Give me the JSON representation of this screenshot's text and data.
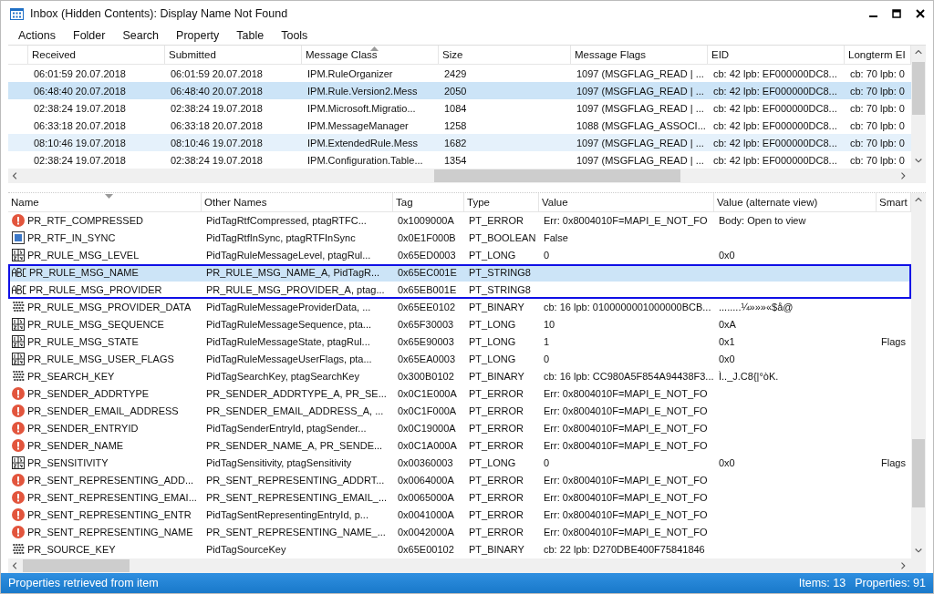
{
  "window": {
    "title": "Inbox (Hidden Contents): Display Name Not Found"
  },
  "menu": [
    "Actions",
    "Folder",
    "Search",
    "Property",
    "Table",
    "Tools"
  ],
  "items_table": {
    "columns": [
      {
        "label": "Received",
        "sorted": false
      },
      {
        "label": "Submitted",
        "sorted": false
      },
      {
        "label": "Message Class",
        "sorted": true
      },
      {
        "label": "Size",
        "sorted": false
      },
      {
        "label": "Message Flags",
        "sorted": false
      },
      {
        "label": "EID",
        "sorted": false
      },
      {
        "label": "Longterm EI",
        "sorted": false
      }
    ],
    "rows": [
      {
        "selected": false,
        "hovered": false,
        "cells": [
          "06:01:59 20.07.2018",
          "06:01:59 20.07.2018",
          "IPM.RuleOrganizer",
          "2429",
          "1097 (MSGFLAG_READ | ...",
          "cb: 42 lpb: EF000000DC8...",
          "cb: 70 lpb: 0"
        ]
      },
      {
        "selected": true,
        "hovered": false,
        "cells": [
          "06:48:40 20.07.2018",
          "06:48:40 20.07.2018",
          "IPM.Rule.Version2.Mess",
          "2050",
          "1097 (MSGFLAG_READ | ...",
          "cb: 42 lpb: EF000000DC8...",
          "cb: 70 lpb: 0"
        ]
      },
      {
        "selected": false,
        "hovered": false,
        "cells": [
          "02:38:24 19.07.2018",
          "02:38:24 19.07.2018",
          "IPM.Microsoft.Migratio...",
          "1084",
          "1097 (MSGFLAG_READ | ...",
          "cb: 42 lpb: EF000000DC8...",
          "cb: 70 lpb: 0"
        ]
      },
      {
        "selected": false,
        "hovered": false,
        "cells": [
          "06:33:18 20.07.2018",
          "06:33:18 20.07.2018",
          "IPM.MessageManager",
          "1258",
          "1088 (MSGFLAG_ASSOCI...",
          "cb: 42 lpb: EF000000DC8...",
          "cb: 70 lpb: 0"
        ]
      },
      {
        "selected": false,
        "hovered": true,
        "cells": [
          "08:10:46 19.07.2018",
          "08:10:46 19.07.2018",
          "IPM.ExtendedRule.Mess",
          "1682",
          "1097 (MSGFLAG_READ | ...",
          "cb: 42 lpb: EF000000DC8...",
          "cb: 70 lpb: 0"
        ]
      },
      {
        "selected": false,
        "hovered": false,
        "cells": [
          "02:38:24 19.07.2018",
          "02:38:24 19.07.2018",
          "IPM.Configuration.Table...",
          "1354",
          "1097 (MSGFLAG_READ | ...",
          "cb: 42 lpb: EF000000DC8...",
          "cb: 70 lpb: 0"
        ]
      }
    ]
  },
  "properties_table": {
    "columns": [
      {
        "label": "Name",
        "sorted": true
      },
      {
        "label": "Other Names",
        "sorted": false
      },
      {
        "label": "Tag",
        "sorted": false
      },
      {
        "label": "Type",
        "sorted": false
      },
      {
        "label": "Value",
        "sorted": false
      },
      {
        "label": "Value (alternate view)",
        "sorted": false
      },
      {
        "label": "Smart",
        "sorted": false
      }
    ],
    "rows": [
      {
        "kind": "error",
        "selected": false,
        "outlined": false,
        "cells": [
          "PR_RTF_COMPRESSED",
          "PidTagRtfCompressed, ptagRTFC...",
          "0x1009000A",
          "PT_ERROR",
          "Err: 0x8004010F=MAPI_E_NOT_FO",
          "Body: Open to view",
          ""
        ]
      },
      {
        "kind": "boolean",
        "selected": false,
        "outlined": false,
        "cells": [
          "PR_RTF_IN_SYNC",
          "PidTagRtfInSync, ptagRTFInSync",
          "0x0E1F000B",
          "PT_BOOLEAN",
          "False",
          "",
          ""
        ]
      },
      {
        "kind": "long",
        "selected": false,
        "outlined": false,
        "cells": [
          "PR_RULE_MSG_LEVEL",
          "PidTagRuleMessageLevel, ptagRul...",
          "0x65ED0003",
          "PT_LONG",
          "0",
          "0x0",
          ""
        ]
      },
      {
        "kind": "string",
        "selected": true,
        "outlined": true,
        "cells": [
          "PR_RULE_MSG_NAME",
          "PR_RULE_MSG_NAME_A, PidTagR...",
          "0x65EC001E",
          "PT_STRING8",
          "",
          "",
          ""
        ]
      },
      {
        "kind": "string",
        "selected": false,
        "outlined": true,
        "cells": [
          "PR_RULE_MSG_PROVIDER",
          "PR_RULE_MSG_PROVIDER_A, ptag...",
          "0x65EB001E",
          "PT_STRING8",
          "",
          "",
          ""
        ]
      },
      {
        "kind": "binary",
        "selected": false,
        "outlined": false,
        "cells": [
          "PR_RULE_MSG_PROVIDER_DATA",
          "PidTagRuleMessageProviderData, ...",
          "0x65EE0102",
          "PT_BINARY",
          "cb: 16 lpb: 0100000001000000BCB...",
          "........¼»»»«$å@",
          ""
        ]
      },
      {
        "kind": "long",
        "selected": false,
        "outlined": false,
        "cells": [
          "PR_RULE_MSG_SEQUENCE",
          "PidTagRuleMessageSequence, pta...",
          "0x65F30003",
          "PT_LONG",
          "10",
          "0xA",
          ""
        ]
      },
      {
        "kind": "long",
        "selected": false,
        "outlined": false,
        "cells": [
          "PR_RULE_MSG_STATE",
          "PidTagRuleMessageState, ptagRul...",
          "0x65E90003",
          "PT_LONG",
          "1",
          "0x1",
          "Flags"
        ]
      },
      {
        "kind": "long",
        "selected": false,
        "outlined": false,
        "cells": [
          "PR_RULE_MSG_USER_FLAGS",
          "PidTagRuleMessageUserFlags, pta...",
          "0x65EA0003",
          "PT_LONG",
          "0",
          "0x0",
          ""
        ]
      },
      {
        "kind": "binary",
        "selected": false,
        "outlined": false,
        "cells": [
          "PR_SEARCH_KEY",
          "PidTagSearchKey, ptagSearchKey",
          "0x300B0102",
          "PT_BINARY",
          "cb: 16 lpb: CC980A5F854A94438F3...",
          "Ì.._J.C8{|°òK.",
          ""
        ]
      },
      {
        "kind": "error",
        "selected": false,
        "outlined": false,
        "cells": [
          "PR_SENDER_ADDRTYPE",
          "PR_SENDER_ADDRTYPE_A, PR_SE...",
          "0x0C1E000A",
          "PT_ERROR",
          "Err: 0x8004010F=MAPI_E_NOT_FO",
          "",
          ""
        ]
      },
      {
        "kind": "error",
        "selected": false,
        "outlined": false,
        "cells": [
          "PR_SENDER_EMAIL_ADDRESS",
          "PR_SENDER_EMAIL_ADDRESS_A, ...",
          "0x0C1F000A",
          "PT_ERROR",
          "Err: 0x8004010F=MAPI_E_NOT_FO",
          "",
          ""
        ]
      },
      {
        "kind": "error",
        "selected": false,
        "outlined": false,
        "cells": [
          "PR_SENDER_ENTRYID",
          "PidTagSenderEntryId, ptagSender...",
          "0x0C19000A",
          "PT_ERROR",
          "Err: 0x8004010F=MAPI_E_NOT_FO",
          "",
          ""
        ]
      },
      {
        "kind": "error",
        "selected": false,
        "outlined": false,
        "cells": [
          "PR_SENDER_NAME",
          "PR_SENDER_NAME_A, PR_SENDE...",
          "0x0C1A000A",
          "PT_ERROR",
          "Err: 0x8004010F=MAPI_E_NOT_FO",
          "",
          ""
        ]
      },
      {
        "kind": "long",
        "selected": false,
        "outlined": false,
        "cells": [
          "PR_SENSITIVITY",
          "PidTagSensitivity, ptagSensitivity",
          "0x00360003",
          "PT_LONG",
          "0",
          "0x0",
          "Flags"
        ]
      },
      {
        "kind": "error",
        "selected": false,
        "outlined": false,
        "cells": [
          "PR_SENT_REPRESENTING_ADD...",
          "PR_SENT_REPRESENTING_ADDRT...",
          "0x0064000A",
          "PT_ERROR",
          "Err: 0x8004010F=MAPI_E_NOT_FO",
          "",
          ""
        ]
      },
      {
        "kind": "error",
        "selected": false,
        "outlined": false,
        "cells": [
          "PR_SENT_REPRESENTING_EMAI...",
          "PR_SENT_REPRESENTING_EMAIL_...",
          "0x0065000A",
          "PT_ERROR",
          "Err: 0x8004010F=MAPI_E_NOT_FO",
          "",
          ""
        ]
      },
      {
        "kind": "error",
        "selected": false,
        "outlined": false,
        "cells": [
          "PR_SENT_REPRESENTING_ENTR",
          "PidTagSentRepresentingEntryId, p...",
          "0x0041000A",
          "PT_ERROR",
          "Err: 0x8004010F=MAPI_E_NOT_FO",
          "",
          ""
        ]
      },
      {
        "kind": "error",
        "selected": false,
        "outlined": false,
        "cells": [
          "PR_SENT_REPRESENTING_NAME",
          "PR_SENT_REPRESENTING_NAME_...",
          "0x0042000A",
          "PT_ERROR",
          "Err: 0x8004010F=MAPI_E_NOT_FO",
          "",
          ""
        ]
      },
      {
        "kind": "binary",
        "selected": false,
        "outlined": false,
        "cells": [
          "PR_SOURCE_KEY",
          "PidTagSourceKey",
          "0x65E00102",
          "PT_BINARY",
          "cb: 22 lpb: D270DBE400F75841846",
          "",
          ""
        ]
      }
    ]
  },
  "status_bar": {
    "message": "Properties retrieved from item",
    "items": "Items: 13",
    "properties": "Properties: 91"
  }
}
